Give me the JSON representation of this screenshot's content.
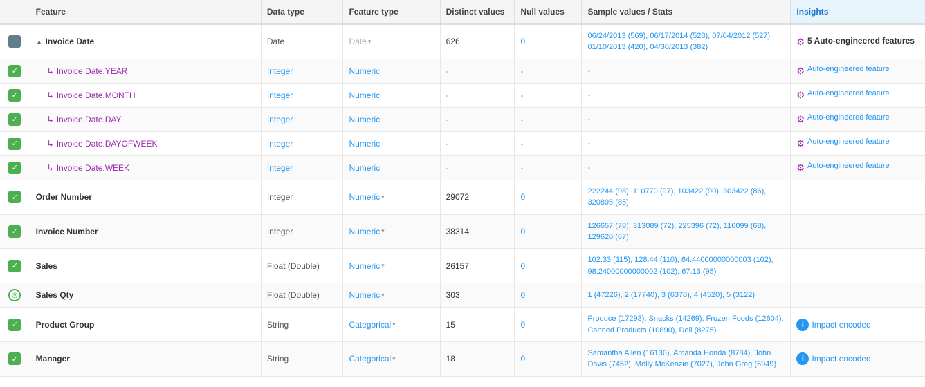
{
  "header": {
    "columns": [
      "",
      "Feature",
      "Data type",
      "Feature type",
      "Distinct values",
      "Null values",
      "Sample values / Stats",
      "Insights"
    ]
  },
  "rows": [
    {
      "id": "invoice-date",
      "checkbox": "minus",
      "feature": "Invoice Date",
      "feature_style": "main",
      "has_collapse": true,
      "data_type": "Date",
      "feature_type": "Date",
      "feature_type_style": "date",
      "has_dropdown": false,
      "distinct": "626",
      "null": "0",
      "null_style": "blue",
      "sample": "06/24/2013 (569), 06/17/2014 (528), 07/04/2012 (527), 01/10/2013 (420), 04/30/2013 (382)",
      "insights_type": "auto-main",
      "insights_text": "5 Auto-engineered features"
    },
    {
      "id": "invoice-date-year",
      "checkbox": "checked",
      "feature": "Invoice Date.YEAR",
      "feature_style": "sub",
      "has_collapse": false,
      "data_type": "Integer",
      "data_type_style": "sub",
      "feature_type": "Numeric",
      "feature_type_style": "numeric",
      "has_dropdown": false,
      "distinct": "-",
      "null": "-",
      "null_style": "dash",
      "sample": "-",
      "insights_type": "auto-sub",
      "insights_text": "Auto-engineered feature"
    },
    {
      "id": "invoice-date-month",
      "checkbox": "checked",
      "feature": "Invoice Date.MONTH",
      "feature_style": "sub",
      "has_collapse": false,
      "data_type": "Integer",
      "data_type_style": "sub",
      "feature_type": "Numeric",
      "feature_type_style": "numeric",
      "has_dropdown": false,
      "distinct": "-",
      "null": "-",
      "null_style": "dash",
      "sample": "-",
      "insights_type": "auto-sub",
      "insights_text": "Auto-engineered feature"
    },
    {
      "id": "invoice-date-day",
      "checkbox": "checked",
      "feature": "Invoice Date.DAY",
      "feature_style": "sub",
      "has_collapse": false,
      "data_type": "Integer",
      "data_type_style": "sub",
      "feature_type": "Numeric",
      "feature_type_style": "numeric",
      "has_dropdown": false,
      "distinct": "-",
      "null": "-",
      "null_style": "dash",
      "sample": "-",
      "insights_type": "auto-sub",
      "insights_text": "Auto-engineered feature"
    },
    {
      "id": "invoice-date-dayofweek",
      "checkbox": "checked",
      "feature": "Invoice Date.DAYOFWEEK",
      "feature_style": "sub",
      "has_collapse": false,
      "data_type": "Integer",
      "data_type_style": "sub",
      "feature_type": "Numeric",
      "feature_type_style": "numeric",
      "has_dropdown": false,
      "distinct": "-",
      "null": "-",
      "null_style": "dash",
      "sample": "-",
      "insights_type": "auto-sub",
      "insights_text": "Auto-engineered feature"
    },
    {
      "id": "invoice-date-week",
      "checkbox": "checked",
      "feature": "Invoice Date.WEEK",
      "feature_style": "sub",
      "has_collapse": false,
      "data_type": "Integer",
      "data_type_style": "sub",
      "feature_type": "Numeric",
      "feature_type_style": "numeric",
      "has_dropdown": false,
      "distinct": "-",
      "null": "-",
      "null_style": "dash",
      "sample": "-",
      "insights_type": "auto-sub",
      "insights_text": "Auto-engineered feature"
    },
    {
      "id": "order-number",
      "checkbox": "checked",
      "feature": "Order Number",
      "feature_style": "main",
      "has_collapse": false,
      "data_type": "Integer",
      "feature_type": "Numeric",
      "feature_type_style": "numeric",
      "has_dropdown": true,
      "distinct": "29072",
      "null": "0",
      "null_style": "blue",
      "sample": "222244 (98), 110770 (97), 103422 (90), 303422 (86), 320895 (85)",
      "insights_type": "none",
      "insights_text": ""
    },
    {
      "id": "invoice-number",
      "checkbox": "checked",
      "feature": "Invoice Number",
      "feature_style": "main",
      "has_collapse": false,
      "data_type": "Integer",
      "feature_type": "Numeric",
      "feature_type_style": "numeric",
      "has_dropdown": true,
      "distinct": "38314",
      "null": "0",
      "null_style": "blue",
      "sample": "126657 (78), 313089 (72), 225396 (72), 116099 (68), 129620 (67)",
      "insights_type": "none",
      "insights_text": ""
    },
    {
      "id": "sales",
      "checkbox": "checked",
      "feature": "Sales",
      "feature_style": "main",
      "has_collapse": false,
      "data_type": "Float (Double)",
      "feature_type": "Numeric",
      "feature_type_style": "numeric",
      "has_dropdown": true,
      "distinct": "26157",
      "null": "0",
      "null_style": "blue",
      "sample": "102.33 (115), 128.44 (110), 64.44000000000003 (102), 98.24000000000002 (102), 67.13 (95)",
      "insights_type": "none",
      "insights_text": ""
    },
    {
      "id": "sales-qty",
      "checkbox": "target",
      "feature": "Sales Qty",
      "feature_style": "main",
      "has_collapse": false,
      "data_type": "Float (Double)",
      "feature_type": "Numeric",
      "feature_type_style": "numeric",
      "has_dropdown": true,
      "distinct": "303",
      "null": "0",
      "null_style": "blue",
      "sample": "1 (47226), 2 (17740), 3 (6378), 4 (4520), 5 (3122)",
      "insights_type": "none",
      "insights_text": ""
    },
    {
      "id": "product-group",
      "checkbox": "checked",
      "feature": "Product Group",
      "feature_style": "main",
      "has_collapse": false,
      "data_type": "String",
      "feature_type": "Categorical",
      "feature_type_style": "categorical",
      "has_dropdown": true,
      "distinct": "15",
      "null": "0",
      "null_style": "blue",
      "sample": "Produce (17293), Snacks (14269), Frozen Foods (12604), Canned Products (10890), Deli (8275)",
      "insights_type": "impact",
      "insights_text": "Impact encoded"
    },
    {
      "id": "manager",
      "checkbox": "checked",
      "feature": "Manager",
      "feature_style": "main",
      "has_collapse": false,
      "data_type": "String",
      "feature_type": "Categorical",
      "feature_type_style": "categorical",
      "has_dropdown": true,
      "distinct": "18",
      "null": "0",
      "null_style": "blue",
      "sample": "Samantha Allen (16136), Amanda Honda (8784), John Davis (7452), Molly McKenzie (7027), John Greg (6949)",
      "insights_type": "impact",
      "insights_text": "Impact encoded"
    }
  ]
}
